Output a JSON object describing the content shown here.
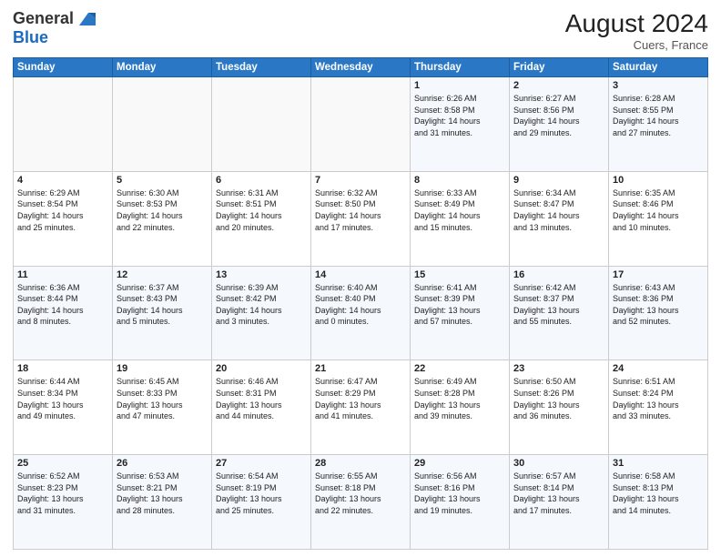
{
  "header": {
    "logo_line1": "General",
    "logo_line2": "Blue",
    "month_year": "August 2024",
    "location": "Cuers, France"
  },
  "weekdays": [
    "Sunday",
    "Monday",
    "Tuesday",
    "Wednesday",
    "Thursday",
    "Friday",
    "Saturday"
  ],
  "weeks": [
    [
      {
        "day": "",
        "info": ""
      },
      {
        "day": "",
        "info": ""
      },
      {
        "day": "",
        "info": ""
      },
      {
        "day": "",
        "info": ""
      },
      {
        "day": "1",
        "info": "Sunrise: 6:26 AM\nSunset: 8:58 PM\nDaylight: 14 hours\nand 31 minutes."
      },
      {
        "day": "2",
        "info": "Sunrise: 6:27 AM\nSunset: 8:56 PM\nDaylight: 14 hours\nand 29 minutes."
      },
      {
        "day": "3",
        "info": "Sunrise: 6:28 AM\nSunset: 8:55 PM\nDaylight: 14 hours\nand 27 minutes."
      }
    ],
    [
      {
        "day": "4",
        "info": "Sunrise: 6:29 AM\nSunset: 8:54 PM\nDaylight: 14 hours\nand 25 minutes."
      },
      {
        "day": "5",
        "info": "Sunrise: 6:30 AM\nSunset: 8:53 PM\nDaylight: 14 hours\nand 22 minutes."
      },
      {
        "day": "6",
        "info": "Sunrise: 6:31 AM\nSunset: 8:51 PM\nDaylight: 14 hours\nand 20 minutes."
      },
      {
        "day": "7",
        "info": "Sunrise: 6:32 AM\nSunset: 8:50 PM\nDaylight: 14 hours\nand 17 minutes."
      },
      {
        "day": "8",
        "info": "Sunrise: 6:33 AM\nSunset: 8:49 PM\nDaylight: 14 hours\nand 15 minutes."
      },
      {
        "day": "9",
        "info": "Sunrise: 6:34 AM\nSunset: 8:47 PM\nDaylight: 14 hours\nand 13 minutes."
      },
      {
        "day": "10",
        "info": "Sunrise: 6:35 AM\nSunset: 8:46 PM\nDaylight: 14 hours\nand 10 minutes."
      }
    ],
    [
      {
        "day": "11",
        "info": "Sunrise: 6:36 AM\nSunset: 8:44 PM\nDaylight: 14 hours\nand 8 minutes."
      },
      {
        "day": "12",
        "info": "Sunrise: 6:37 AM\nSunset: 8:43 PM\nDaylight: 14 hours\nand 5 minutes."
      },
      {
        "day": "13",
        "info": "Sunrise: 6:39 AM\nSunset: 8:42 PM\nDaylight: 14 hours\nand 3 minutes."
      },
      {
        "day": "14",
        "info": "Sunrise: 6:40 AM\nSunset: 8:40 PM\nDaylight: 14 hours\nand 0 minutes."
      },
      {
        "day": "15",
        "info": "Sunrise: 6:41 AM\nSunset: 8:39 PM\nDaylight: 13 hours\nand 57 minutes."
      },
      {
        "day": "16",
        "info": "Sunrise: 6:42 AM\nSunset: 8:37 PM\nDaylight: 13 hours\nand 55 minutes."
      },
      {
        "day": "17",
        "info": "Sunrise: 6:43 AM\nSunset: 8:36 PM\nDaylight: 13 hours\nand 52 minutes."
      }
    ],
    [
      {
        "day": "18",
        "info": "Sunrise: 6:44 AM\nSunset: 8:34 PM\nDaylight: 13 hours\nand 49 minutes."
      },
      {
        "day": "19",
        "info": "Sunrise: 6:45 AM\nSunset: 8:33 PM\nDaylight: 13 hours\nand 47 minutes."
      },
      {
        "day": "20",
        "info": "Sunrise: 6:46 AM\nSunset: 8:31 PM\nDaylight: 13 hours\nand 44 minutes."
      },
      {
        "day": "21",
        "info": "Sunrise: 6:47 AM\nSunset: 8:29 PM\nDaylight: 13 hours\nand 41 minutes."
      },
      {
        "day": "22",
        "info": "Sunrise: 6:49 AM\nSunset: 8:28 PM\nDaylight: 13 hours\nand 39 minutes."
      },
      {
        "day": "23",
        "info": "Sunrise: 6:50 AM\nSunset: 8:26 PM\nDaylight: 13 hours\nand 36 minutes."
      },
      {
        "day": "24",
        "info": "Sunrise: 6:51 AM\nSunset: 8:24 PM\nDaylight: 13 hours\nand 33 minutes."
      }
    ],
    [
      {
        "day": "25",
        "info": "Sunrise: 6:52 AM\nSunset: 8:23 PM\nDaylight: 13 hours\nand 31 minutes."
      },
      {
        "day": "26",
        "info": "Sunrise: 6:53 AM\nSunset: 8:21 PM\nDaylight: 13 hours\nand 28 minutes."
      },
      {
        "day": "27",
        "info": "Sunrise: 6:54 AM\nSunset: 8:19 PM\nDaylight: 13 hours\nand 25 minutes."
      },
      {
        "day": "28",
        "info": "Sunrise: 6:55 AM\nSunset: 8:18 PM\nDaylight: 13 hours\nand 22 minutes."
      },
      {
        "day": "29",
        "info": "Sunrise: 6:56 AM\nSunset: 8:16 PM\nDaylight: 13 hours\nand 19 minutes."
      },
      {
        "day": "30",
        "info": "Sunrise: 6:57 AM\nSunset: 8:14 PM\nDaylight: 13 hours\nand 17 minutes."
      },
      {
        "day": "31",
        "info": "Sunrise: 6:58 AM\nSunset: 8:13 PM\nDaylight: 13 hours\nand 14 minutes."
      }
    ]
  ]
}
